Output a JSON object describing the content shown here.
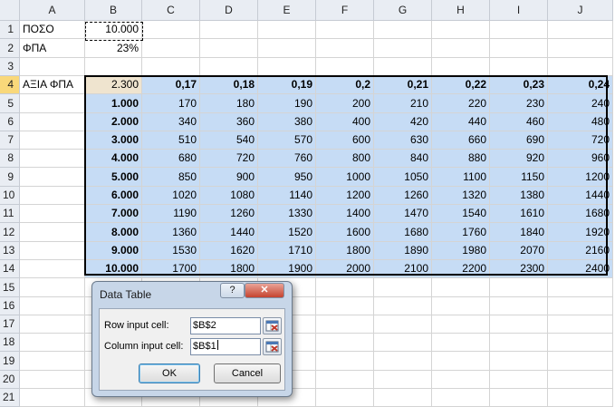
{
  "columns": [
    "A",
    "B",
    "C",
    "D",
    "E",
    "F",
    "G",
    "H",
    "I",
    "J"
  ],
  "rows": [
    "1",
    "2",
    "3",
    "4",
    "5",
    "6",
    "7",
    "8",
    "9",
    "10",
    "11",
    "12",
    "13",
    "14",
    "15",
    "16",
    "17",
    "18",
    "19",
    "20",
    "21"
  ],
  "cells": {
    "A1": "ΠΟΣΟ",
    "B1": "10.000",
    "A2": "ΦΠΑ",
    "B2": "23%",
    "A4": "ΑΞΙΑ ΦΠΑ",
    "B4": "2.300"
  },
  "top_headers": [
    "0,17",
    "0,18",
    "0,19",
    "0,2",
    "0,21",
    "0,22",
    "0,23",
    "0,24"
  ],
  "left_headers": [
    "1.000",
    "2.000",
    "3.000",
    "4.000",
    "5.000",
    "6.000",
    "7.000",
    "8.000",
    "9.000",
    "10.000"
  ],
  "table_values": [
    [
      "170",
      "180",
      "190",
      "200",
      "210",
      "220",
      "230",
      "240"
    ],
    [
      "340",
      "360",
      "380",
      "400",
      "420",
      "440",
      "460",
      "480"
    ],
    [
      "510",
      "540",
      "570",
      "600",
      "630",
      "660",
      "690",
      "720"
    ],
    [
      "680",
      "720",
      "760",
      "800",
      "840",
      "880",
      "920",
      "960"
    ],
    [
      "850",
      "900",
      "950",
      "1000",
      "1050",
      "1100",
      "1150",
      "1200"
    ],
    [
      "1020",
      "1080",
      "1140",
      "1200",
      "1260",
      "1320",
      "1380",
      "1440"
    ],
    [
      "1190",
      "1260",
      "1330",
      "1400",
      "1470",
      "1540",
      "1610",
      "1680"
    ],
    [
      "1360",
      "1440",
      "1520",
      "1600",
      "1680",
      "1760",
      "1840",
      "1920"
    ],
    [
      "1530",
      "1620",
      "1710",
      "1800",
      "1890",
      "1980",
      "2070",
      "2160"
    ],
    [
      "1700",
      "1800",
      "1900",
      "2000",
      "2100",
      "2200",
      "2300",
      "2400"
    ]
  ],
  "dialog": {
    "title": "Data Table",
    "help_label": "?",
    "close_label": "✕",
    "row_input_label": "Row input cell:",
    "row_input_value": "$B$2",
    "column_input_label": "Column input cell:",
    "column_input_value": "$B$1",
    "ok_label": "OK",
    "cancel_label": "Cancel"
  },
  "colors": {
    "table_fill": "#c6dcf5",
    "header_fill": "#e9edf3",
    "selected_header": "#f9d87a"
  }
}
